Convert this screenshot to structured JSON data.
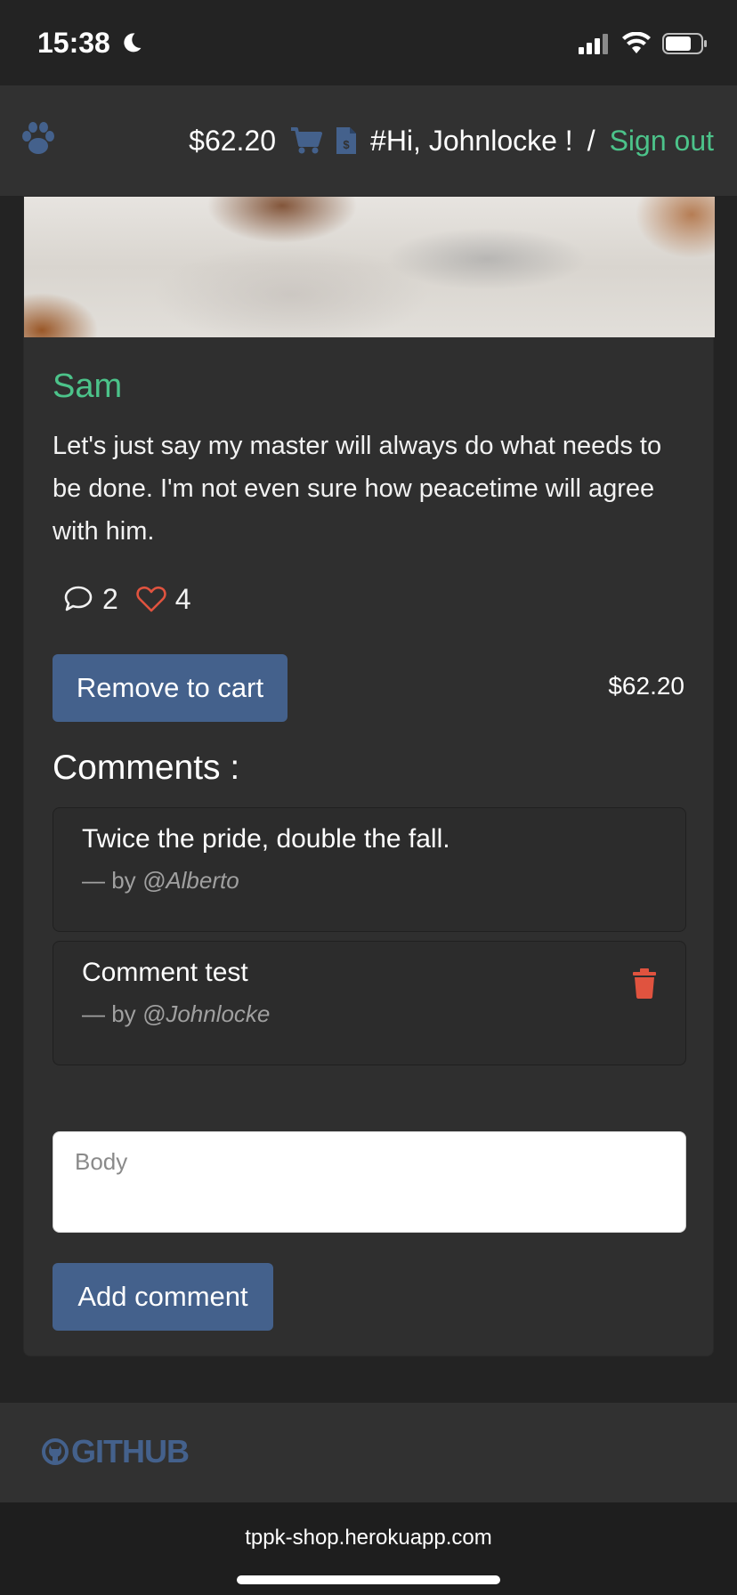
{
  "status_bar": {
    "time": "15:38"
  },
  "navbar": {
    "cart_total": "$62.20",
    "greeting": "#Hi, Johnlocke !",
    "separator": "/",
    "sign_out": "Sign out"
  },
  "pet": {
    "name": "Sam",
    "description": "Let's just say my master will always do what needs to be done. I'm not even sure how peacetime will agree with him.",
    "comment_count": "2",
    "like_count": "4",
    "cart_button": "Remove to cart",
    "price": "$62.20"
  },
  "comments": {
    "title": "Comments :",
    "items": [
      {
        "body": "Twice the pride, double the fall.",
        "prefix": "— by ",
        "author": "@Alberto"
      },
      {
        "body": "Comment test",
        "prefix": "— by ",
        "author": "@Johnlocke"
      }
    ]
  },
  "form": {
    "body_placeholder": "Body",
    "submit": "Add comment"
  },
  "footer": {
    "github": "GITHUB"
  },
  "browser": {
    "url": "tppk-shop.herokuapp.com"
  },
  "colors": {
    "accent_green": "#4cc38a",
    "button_blue": "#44618c",
    "delete_red": "#e0533f"
  }
}
